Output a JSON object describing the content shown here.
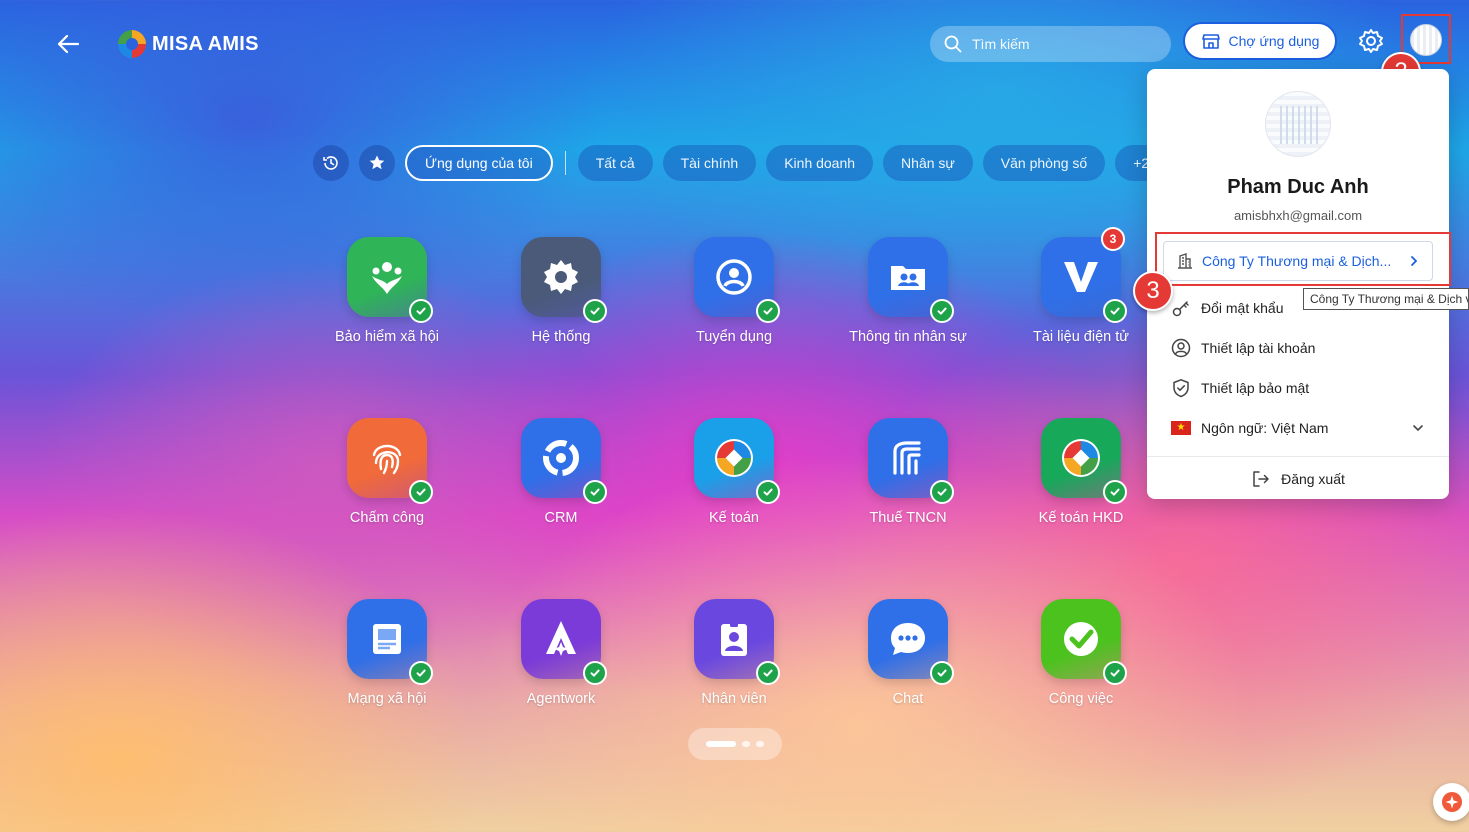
{
  "header": {
    "logo_text": "MISA AMIS",
    "search_placeholder": "Tìm kiếm",
    "market_label": "Chợ ứng dụng"
  },
  "filters": {
    "chips": [
      "Ứng dụng của tôi",
      "Tất cả",
      "Tài chính",
      "Kinh doanh",
      "Nhân sự",
      "Văn phòng số",
      "+2"
    ],
    "active_index": 0
  },
  "apps": [
    {
      "label": "Bảo hiểm xã hội",
      "icon": "social-insurance-icon",
      "color": "#2fb457"
    },
    {
      "label": "Hệ thống",
      "icon": "gear-icon",
      "color": "#4a5a78"
    },
    {
      "label": "Tuyển dụng",
      "icon": "recruitment-icon",
      "color": "#2f6fe8"
    },
    {
      "label": "Thông tin nhân sự",
      "icon": "hr-info-icon",
      "color": "#2f6fe8"
    },
    {
      "label": "Tài liệu điện tử",
      "icon": "e-document-icon",
      "color": "#2f6fe8",
      "badge": "3"
    },
    {
      "label": "Chấm công",
      "icon": "fingerprint-icon",
      "color": "#f06a3a"
    },
    {
      "label": "CRM",
      "icon": "crm-icon",
      "color": "#2f6fe8"
    },
    {
      "label": "Kế toán",
      "icon": "accounting-icon",
      "color": "#1aa0e8"
    },
    {
      "label": "Thuế TNCN",
      "icon": "tax-icon",
      "color": "#2f6fe8"
    },
    {
      "label": "Kế toán HKD",
      "icon": "accounting-hkd-icon",
      "color": "#17a85a"
    },
    {
      "label": "Mạng xã hội",
      "icon": "social-network-icon",
      "color": "#2f6fe8"
    },
    {
      "label": "Agentwork",
      "icon": "agentwork-icon",
      "color": "#7a3bd8"
    },
    {
      "label": "Nhân viên",
      "icon": "employee-icon",
      "color": "#6a48e0"
    },
    {
      "label": "Chat",
      "icon": "chat-icon",
      "color": "#2f6fe8"
    },
    {
      "label": "Công việc",
      "icon": "task-icon",
      "color": "#4cc21e"
    }
  ],
  "profile": {
    "name": "Pham Duc Anh",
    "email": "amisbhxh@gmail.com",
    "company": "Công Ty Thương mại & Dịch...",
    "tooltip": "Công Ty Thương mại & Dịch v",
    "menu": [
      {
        "label": "Đổi mật khẩu",
        "icon": "key-icon"
      },
      {
        "label": "Thiết lập tài khoản",
        "icon": "account-icon"
      },
      {
        "label": "Thiết lập bảo mật",
        "icon": "shield-icon"
      },
      {
        "label": "Ngôn ngữ: Việt Nam",
        "icon": "vietnam-flag-icon"
      }
    ],
    "logout": "Đăng xuất"
  },
  "annotations": {
    "step2": "2",
    "step3": "3"
  }
}
